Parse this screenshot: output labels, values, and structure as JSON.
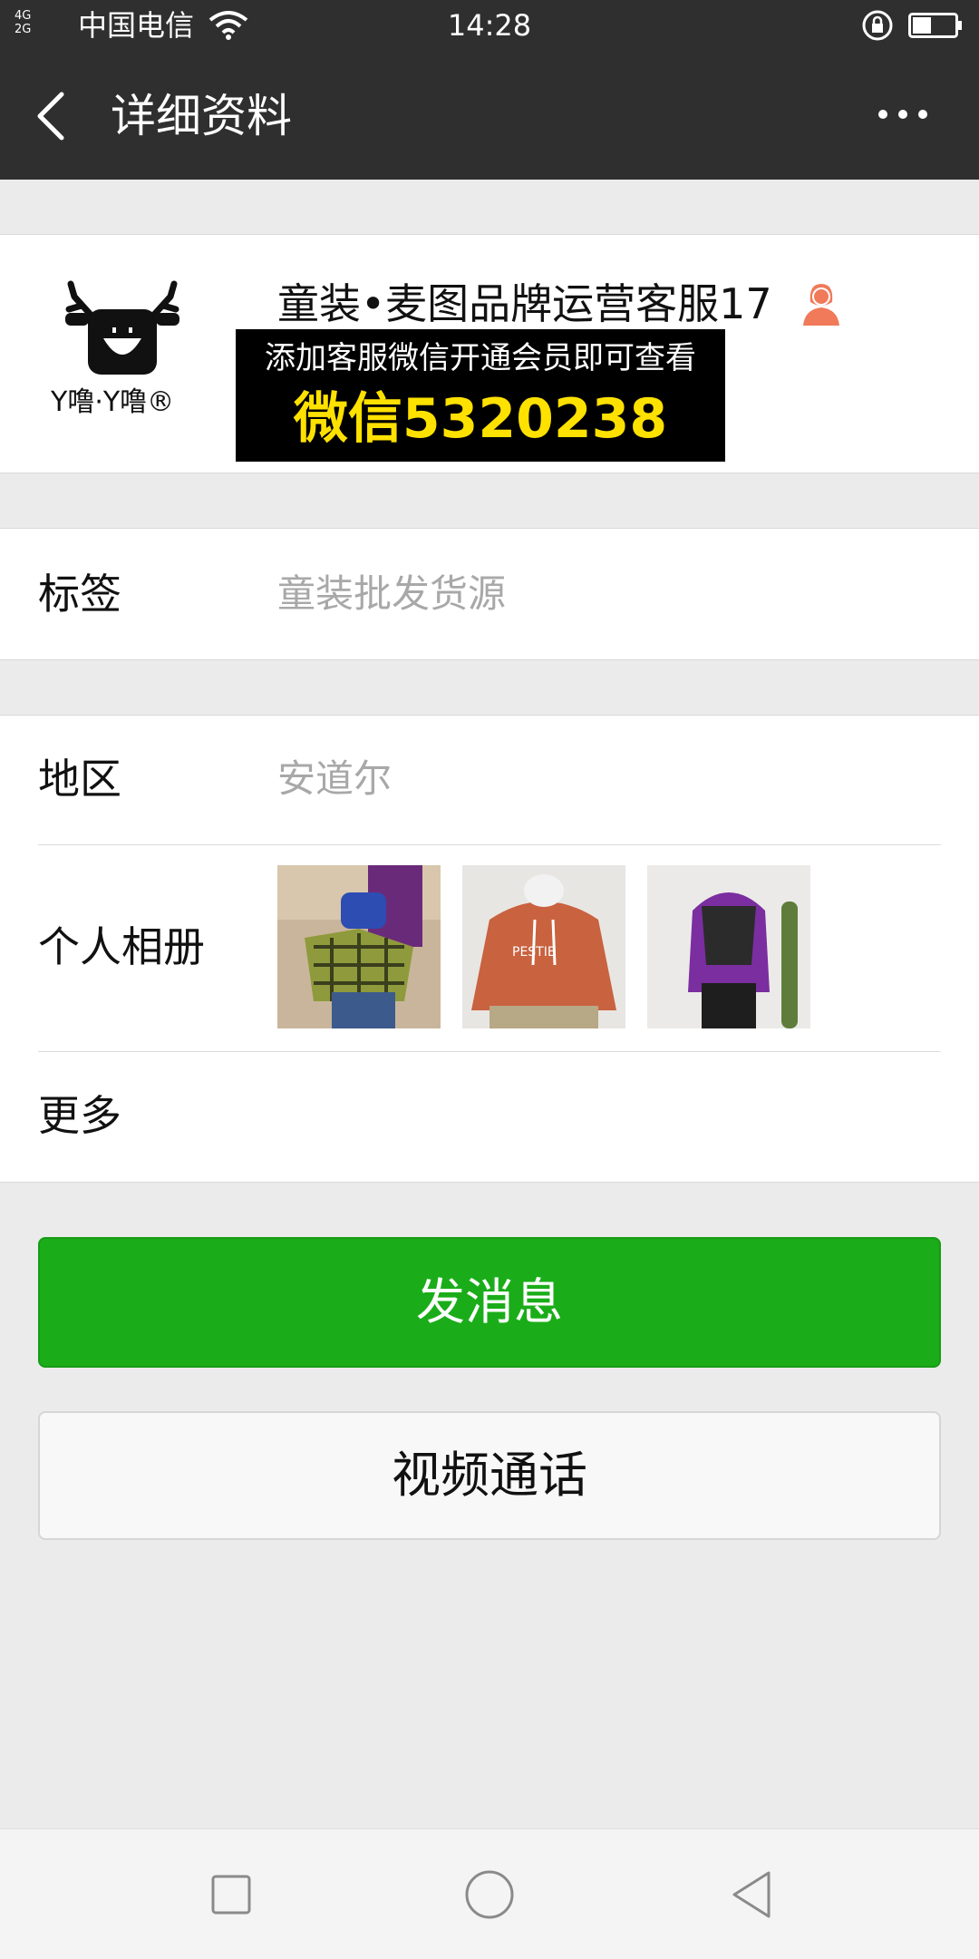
{
  "status_bar": {
    "network": "4G 2G",
    "carrier": "中国电信",
    "time": "14:28",
    "icons": [
      "wifi-icon",
      "rotation-lock-icon",
      "battery-icon"
    ]
  },
  "nav": {
    "title": "详细资料",
    "back_icon": "back-chevron-icon",
    "more_icon": "more-dots-icon"
  },
  "profile": {
    "avatar_text": "Y噜·Y噜®",
    "name": "童装•麦图品牌运营客服17",
    "gender_icon": "female-person-icon",
    "promo_line1": "添加客服微信开通会员即可查看",
    "promo_line2": "微信5320238"
  },
  "rows": {
    "tag_label": "标签",
    "tag_value": "童装批发货源",
    "region_label": "地区",
    "region_value": "安道尔",
    "album_label": "个人相册",
    "more_label": "更多"
  },
  "buttons": {
    "send_message": "发消息",
    "video_call": "视频通话"
  },
  "colors": {
    "nav_bg": "#2f2f2f",
    "primary_green": "#1aad19",
    "page_bg": "#ebebeb",
    "promo_yellow": "#ffe100",
    "gender_icon": "#f07a5a"
  }
}
